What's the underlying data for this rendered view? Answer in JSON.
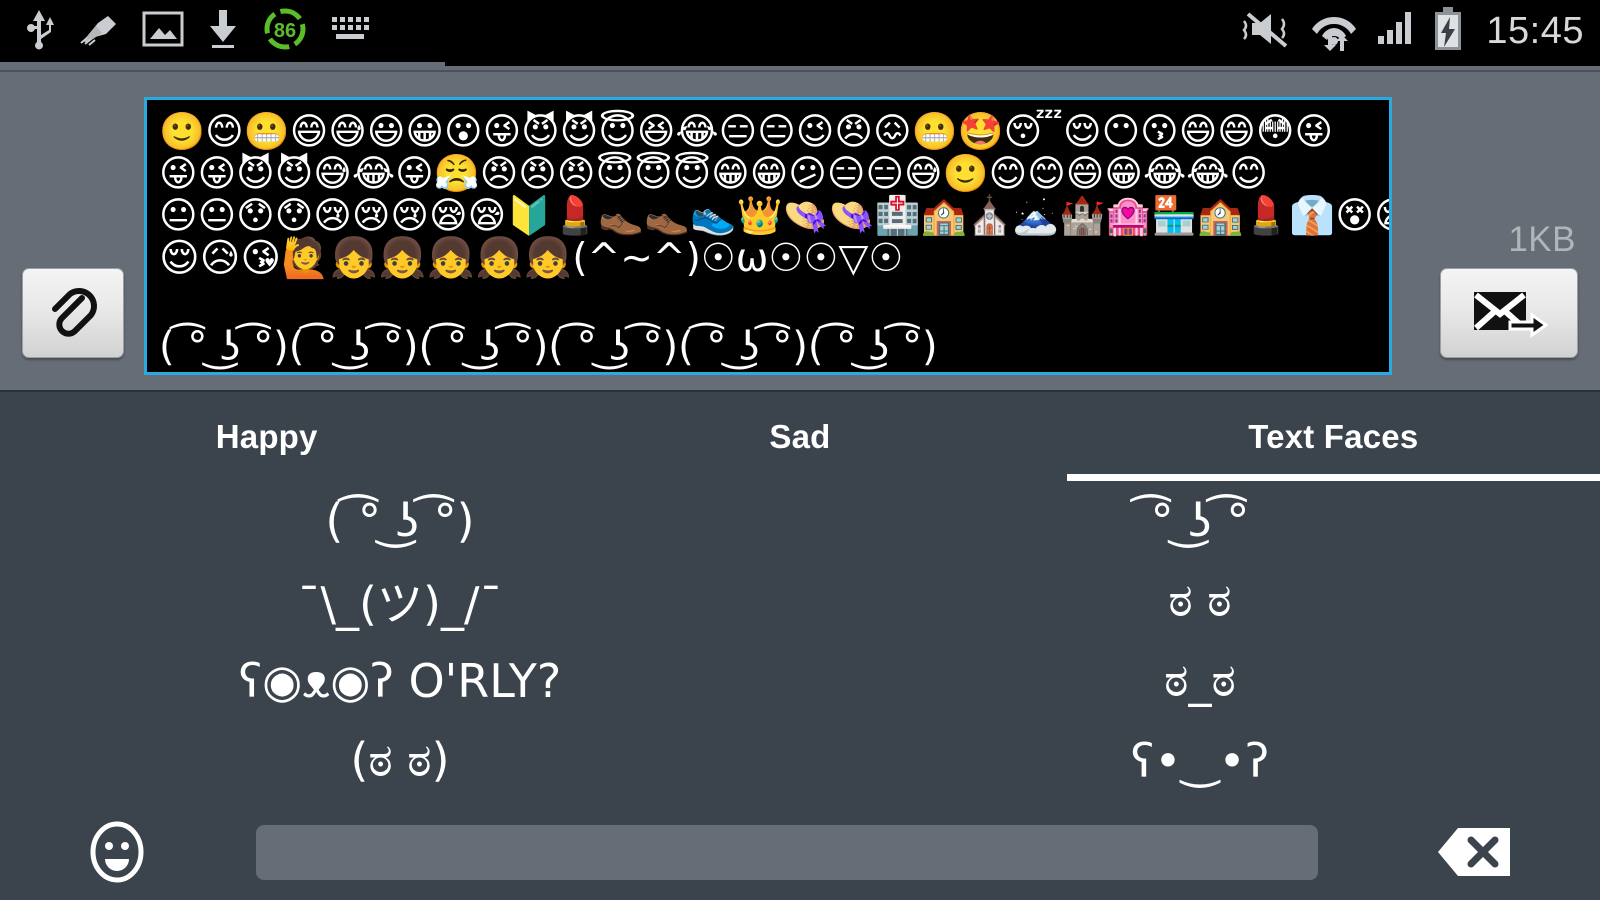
{
  "statusbar": {
    "time": "15:45",
    "left_icons": [
      {
        "name": "usb-icon",
        "label": "USB"
      },
      {
        "name": "cleaner-icon",
        "label": "Cleaner"
      },
      {
        "name": "screenshot-image-icon",
        "label": "Screenshot"
      },
      {
        "name": "download-icon",
        "label": "Download"
      },
      {
        "name": "battery-percent-icon",
        "label": "86"
      },
      {
        "name": "keyboard-icon",
        "label": "Keyboard"
      }
    ],
    "battery_percent": "86",
    "right_icons": [
      {
        "name": "mute-vibrate-icon",
        "label": "Silent / Vibrate"
      },
      {
        "name": "wifi-icon",
        "label": "Wi-Fi"
      },
      {
        "name": "cellular-signal-icon",
        "label": "Signal"
      },
      {
        "name": "battery-charging-icon",
        "label": "Charging"
      }
    ]
  },
  "compose": {
    "attach_label": "Attach",
    "send_label": "Send",
    "size_label": "1KB",
    "message_rows": [
      "🙂😊😬😄😅😃😀😮😜😈😈😇😆😂😑😑😉😠😖😬🤩😴😌😶😗😄😄😳😜",
      "😜😜😈😈😅😂😜😤😠😠😠😇😇😇😁😁😕😑😑😅🙂😊😊😄😁😂😂😊",
      "😐😐😯😯😢😢😢😪😪🔰💄👞👞👟👑👒👒🏥🏫⛪🗻🏰🏩🏪🏫💄👔😵😪",
      "😌😥😘🙋👧👧👧👧👧(^~^)☉ω☉☉▽☉"
    ],
    "lenny_row": "( ͡° ͜ʖ ͡°)( ͡° ͜ʖ ͡°)( ͡° ͜ʖ ͡°)( ͡° ͜ʖ ͡°)( ͡° ͜ʖ ͡°)( ͡° ͜ʖ ͡°)"
  },
  "tabs": [
    {
      "label": "Happy",
      "active": false
    },
    {
      "label": "Sad",
      "active": false
    },
    {
      "label": "Text Faces",
      "active": true
    }
  ],
  "face_grid": [
    {
      "left": "( ͡° ͜ʖ ͡°)",
      "right": " ͡° ͜ʖ ͡°"
    },
    {
      "left": "¯\\_(ツ)_/¯",
      "right": "ಠ ಠ"
    },
    {
      "left": "ʕ◉ᴥ◉ʔ O'RLY?",
      "right": "ಠ_ಠ"
    },
    {
      "left": "(ಠ ಠ)",
      "right": "ʕ•‿•ʔ"
    }
  ],
  "keyrow": {
    "emoji_key_label": "Emoji",
    "spacebar_label": "",
    "backspace_label": "Delete"
  },
  "colors": {
    "status_bg": "#000000",
    "page_bg": "#666d76",
    "panel_bg": "#3b444c",
    "accent_border": "#29abe2",
    "text_light": "#ffffff",
    "battery_green": "#5bbd2a"
  }
}
